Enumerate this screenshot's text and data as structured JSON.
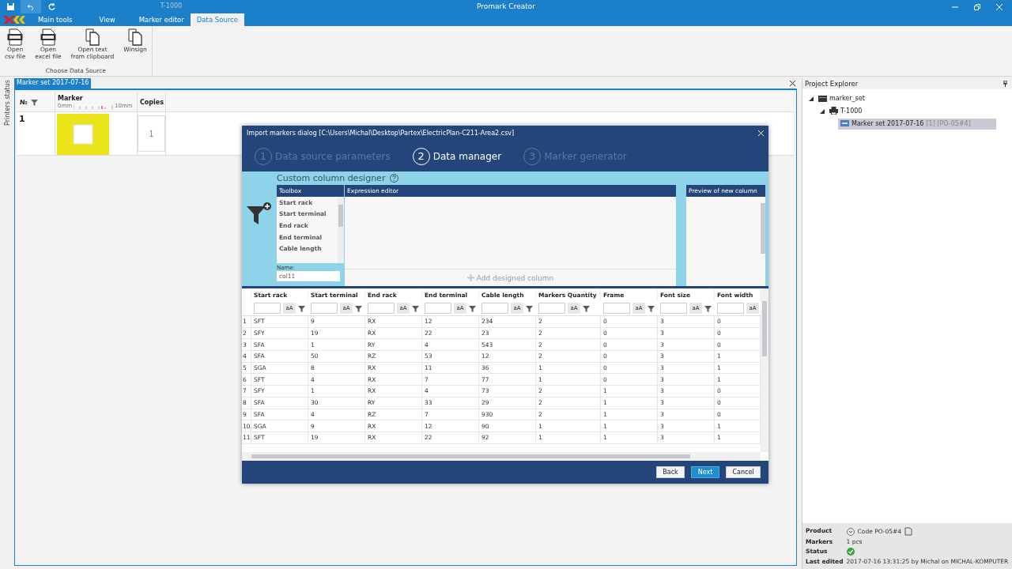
{
  "app": {
    "title": "Promark Creator",
    "context_group": "T-1000"
  },
  "ribbon_tabs": [
    {
      "label": "Main tools",
      "selected": false
    },
    {
      "label": "View",
      "selected": false
    },
    {
      "label": "Marker editor",
      "selected": false
    },
    {
      "label": "Data Source",
      "selected": true
    }
  ],
  "ribbon_buttons": [
    {
      "lines": [
        "Open",
        "csv file"
      ],
      "kind": "csv"
    },
    {
      "lines": [
        "Open",
        "excel file"
      ],
      "kind": "xls"
    },
    {
      "lines": [
        "Open text",
        "from clipboard"
      ],
      "kind": "copy"
    },
    {
      "lines": [
        "Winsign"
      ],
      "kind": "copy"
    }
  ],
  "ribbon_group": "Choose Data Source",
  "side_strip": "Printers status",
  "document_tab": "Marker set 2017-07-16",
  "marker_grid": {
    "columns": [
      "№",
      "Marker",
      "Copies"
    ],
    "ruler": [
      "0mm",
      "10mm"
    ],
    "rows": [
      {
        "number": "1",
        "copies": "1"
      }
    ]
  },
  "dialog": {
    "title": "Import markers dialog [C:\\Users\\Michal\\Desktop\\Partex\\ElectricPlan-C211-Area2.csv]",
    "steps": [
      {
        "number": "1",
        "label": "Data source parameters",
        "selected": false
      },
      {
        "number": "2",
        "label": "Data manager",
        "selected": true
      },
      {
        "number": "3",
        "label": "Marker generator",
        "selected": false
      }
    ],
    "designer": {
      "title": "Custom column designer",
      "toolbox_header": "Toolbox",
      "toolbox_items": [
        "Start rack",
        "Start terminal",
        "End rack",
        "End terminal",
        "Cable length"
      ],
      "name_label": "Name:",
      "name_value": "col11",
      "expression_header": "Expression editor",
      "add_button": "Add designed column",
      "preview_header": "Preview of new column"
    },
    "table": {
      "columns": [
        {
          "label": "Start rack",
          "case_button": "aA"
        },
        {
          "label": "Start terminal",
          "case_button": "aA"
        },
        {
          "label": "End rack",
          "case_button": "aA"
        },
        {
          "label": "End terminal",
          "case_button": "aA"
        },
        {
          "label": "Cable length",
          "case_button": "aA"
        },
        {
          "label": "Markers Quantity",
          "case_button": "aA"
        },
        {
          "label": "Frame",
          "case_button": "aA"
        },
        {
          "label": "Font size",
          "case_button": "aA"
        },
        {
          "label": "Font width",
          "case_button": "aA"
        }
      ],
      "rows": [
        {
          "number": "1",
          "cells": [
            "SFT",
            "9",
            "RX",
            "12",
            "234",
            "2",
            "0",
            "3",
            "0"
          ]
        },
        {
          "number": "2",
          "cells": [
            "SFY",
            "19",
            "RX",
            "22",
            "23",
            "2",
            "0",
            "3",
            "0"
          ]
        },
        {
          "number": "3",
          "cells": [
            "SFA",
            "1",
            "RY",
            "4",
            "543",
            "2",
            "0",
            "3",
            "0"
          ]
        },
        {
          "number": "4",
          "cells": [
            "SFA",
            "50",
            "RZ",
            "53",
            "12",
            "2",
            "0",
            "3",
            "1"
          ]
        },
        {
          "number": "5",
          "cells": [
            "SGA",
            "8",
            "RX",
            "11",
            "36",
            "1",
            "0",
            "3",
            "1"
          ]
        },
        {
          "number": "6",
          "cells": [
            "SFT",
            "4",
            "RX",
            "7",
            "77",
            "1",
            "0",
            "3",
            "1"
          ]
        },
        {
          "number": "7",
          "cells": [
            "SFY",
            "1",
            "RX",
            "4",
            "73",
            "2",
            "1",
            "3",
            "0"
          ]
        },
        {
          "number": "8",
          "cells": [
            "SFA",
            "30",
            "RY",
            "33",
            "29",
            "2",
            "1",
            "3",
            "0"
          ]
        },
        {
          "number": "9",
          "cells": [
            "SFA",
            "4",
            "RZ",
            "7",
            "930",
            "2",
            "1",
            "3",
            "0"
          ]
        },
        {
          "number": "10",
          "cells": [
            "SGA",
            "9",
            "RX",
            "12",
            "90",
            "1",
            "1",
            "3",
            "1"
          ]
        },
        {
          "number": "11",
          "cells": [
            "SFT",
            "19",
            "RX",
            "22",
            "92",
            "1",
            "1",
            "3",
            "1"
          ]
        }
      ]
    },
    "buttons": [
      {
        "label": "Back",
        "selected": false
      },
      {
        "label": "Next",
        "selected": true
      },
      {
        "label": "Cancel",
        "selected": false
      }
    ]
  },
  "project_explorer": {
    "title": "Project Explorer",
    "tree": [
      {
        "label": "marker_set",
        "kind": "folder",
        "expanded": true,
        "selected": false,
        "children": [
          {
            "label": "T-1000",
            "kind": "printer",
            "expanded": true,
            "selected": false,
            "children": [
              {
                "label": "Marker set 2017-07-16",
                "suffix": "[1] [PO-05#4]",
                "kind": "set",
                "selected": true
              }
            ]
          }
        ]
      }
    ]
  },
  "properties": [
    {
      "label": "Product",
      "value": "Code PO-05#4",
      "kind": "product"
    },
    {
      "label": "Markers",
      "value": "1 pcs",
      "kind": "text"
    },
    {
      "label": "Status",
      "kind": "status"
    },
    {
      "label": "Last edited",
      "value": "2017-07-16 13:31:25 by Michal on MICHAL-KOMPUTER",
      "kind": "text"
    }
  ]
}
